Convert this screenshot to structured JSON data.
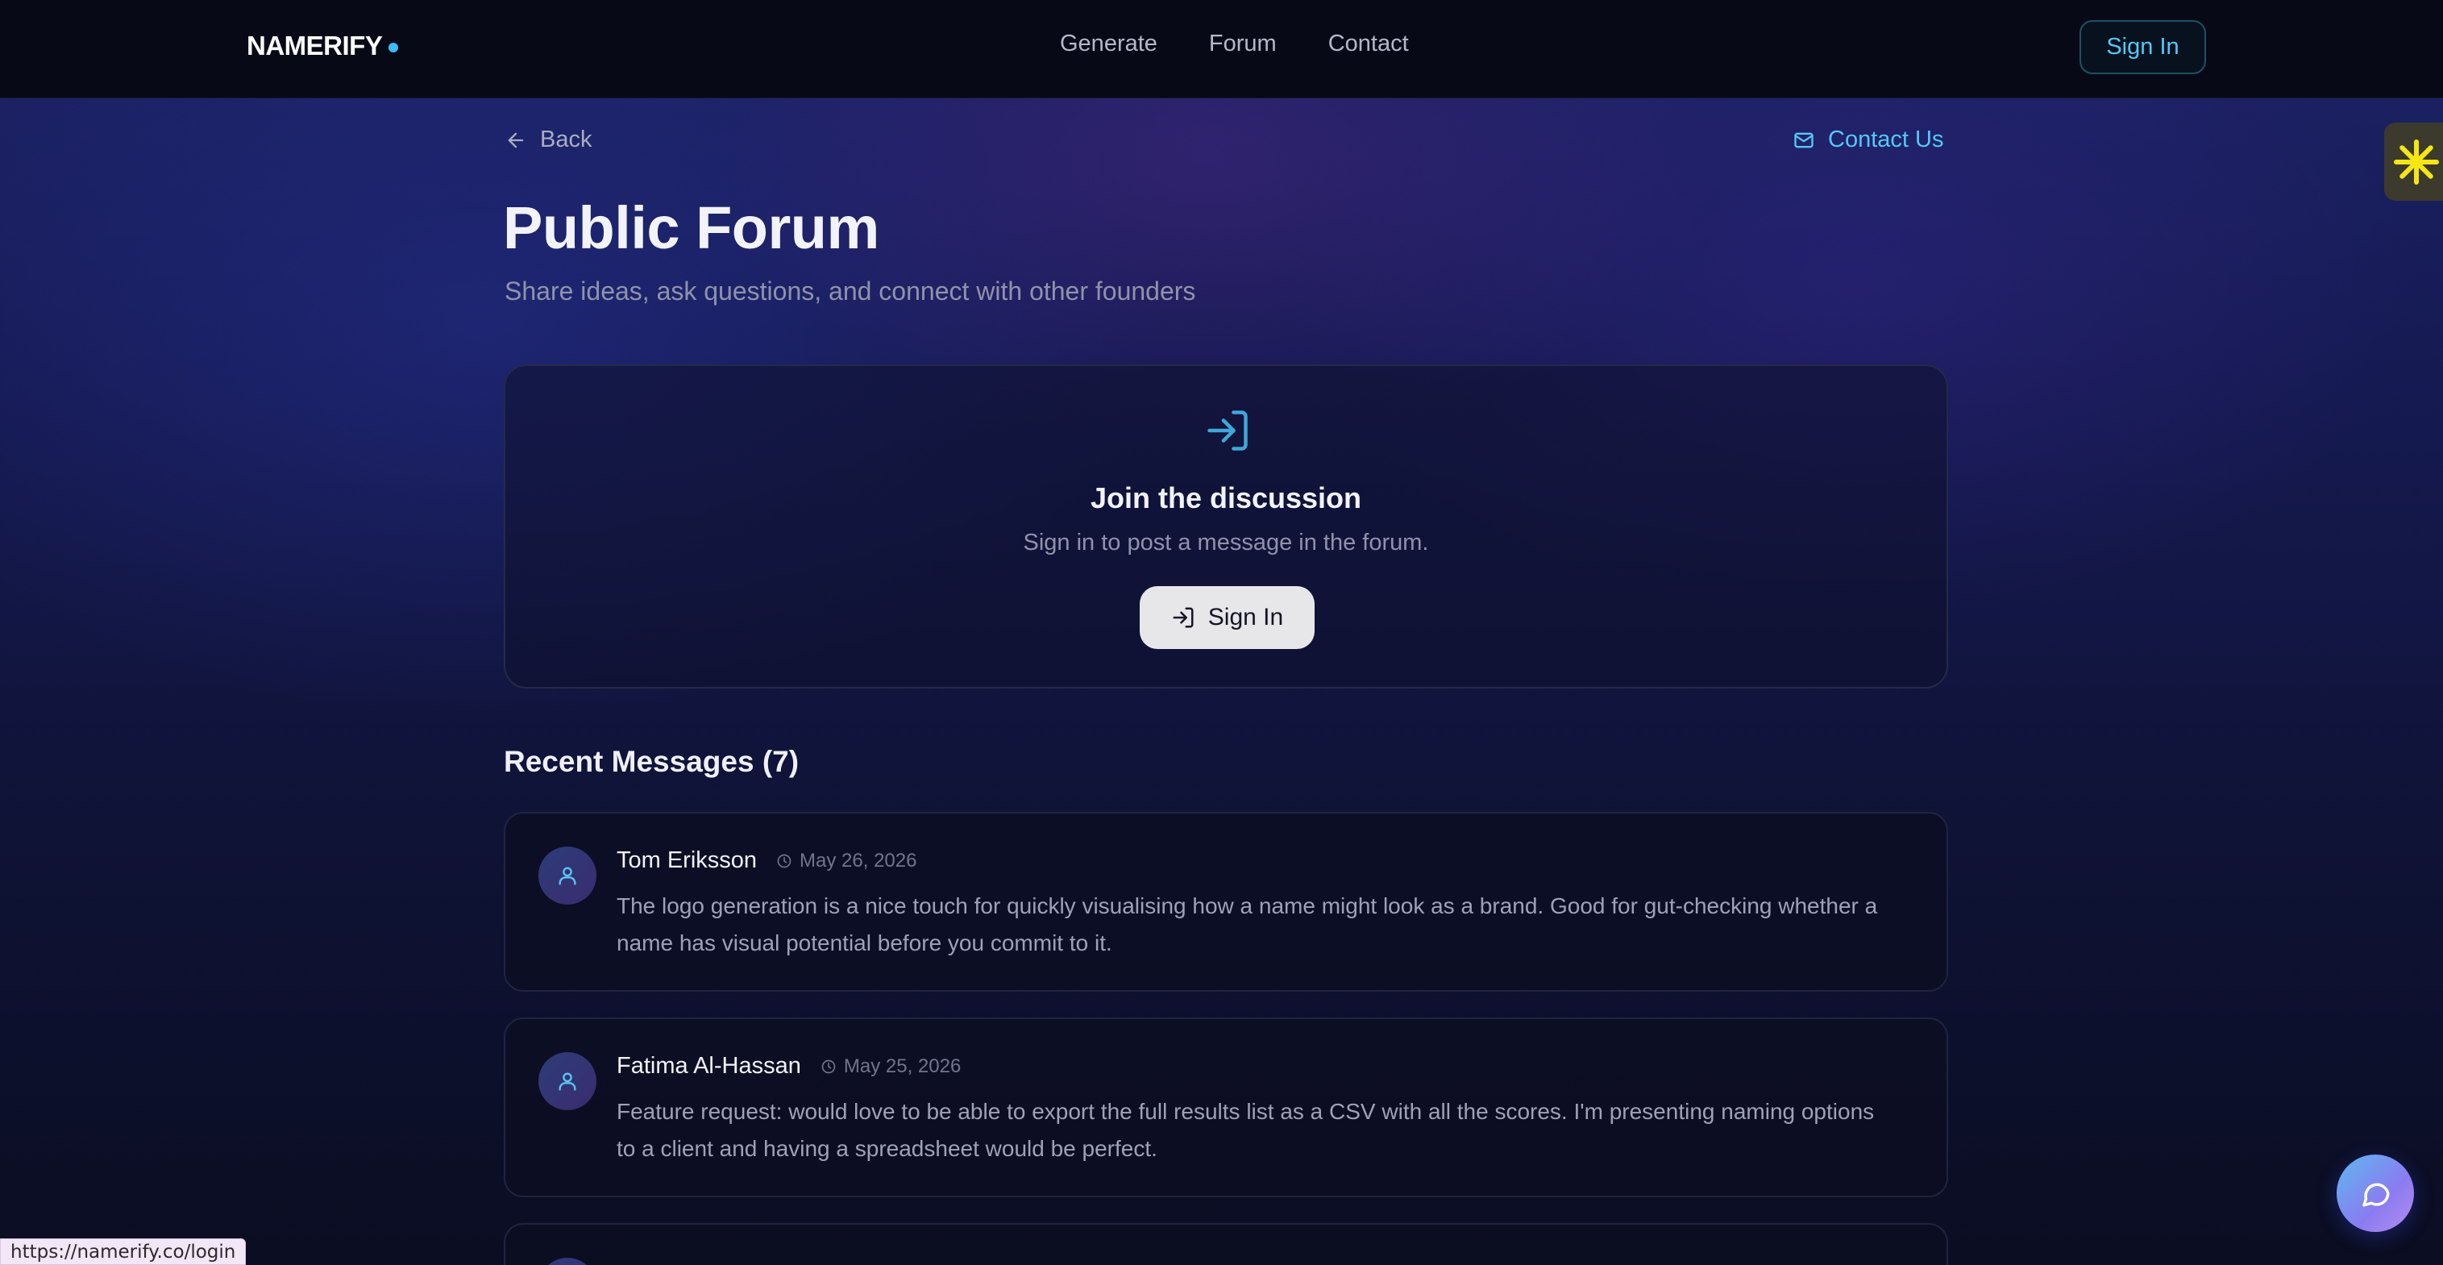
{
  "nav": {
    "logo": "NAMERIFY",
    "links": [
      "Generate",
      "Forum",
      "Contact"
    ],
    "signin_label": "Sign In"
  },
  "subheader": {
    "back_label": "Back",
    "contact_label": "Contact Us"
  },
  "page": {
    "title": "Public Forum",
    "subtitle": "Share ideas, ask questions, and connect with other founders"
  },
  "join": {
    "title": "Join the discussion",
    "subtitle": "Sign in to post a message in the forum.",
    "button_label": "Sign In"
  },
  "recent": {
    "title": "Recent Messages (7)",
    "messages": [
      {
        "author": "Tom Eriksson",
        "date": "May 26, 2026",
        "body": "The logo generation is a nice touch for quickly visualising how a name might look as a brand. Good for gut-checking whether a name has visual potential before you commit to it."
      },
      {
        "author": "Fatima Al-Hassan",
        "date": "May 25, 2026",
        "body": "Feature request: would love to be able to export the full results list as a CSV with all the scores. I'm presenting naming options to a client and having a spreadsheet would be perfect."
      }
    ]
  },
  "status_bar": {
    "url": "https://namerify.co/login"
  },
  "colors": {
    "accent": "#56c7f5",
    "nav_bg": "#070a16",
    "page_bg_top": "#1c2366",
    "page_bg_bottom": "#0b0d22",
    "widget_icon": "#f5e614"
  },
  "icons": {
    "back": "arrow-left-icon",
    "contact": "mail-icon",
    "join": "log-in-icon",
    "avatar": "user-icon",
    "date": "clock-icon",
    "widget": "asterisk-burst-icon",
    "chat": "chat-bubble-icon"
  }
}
